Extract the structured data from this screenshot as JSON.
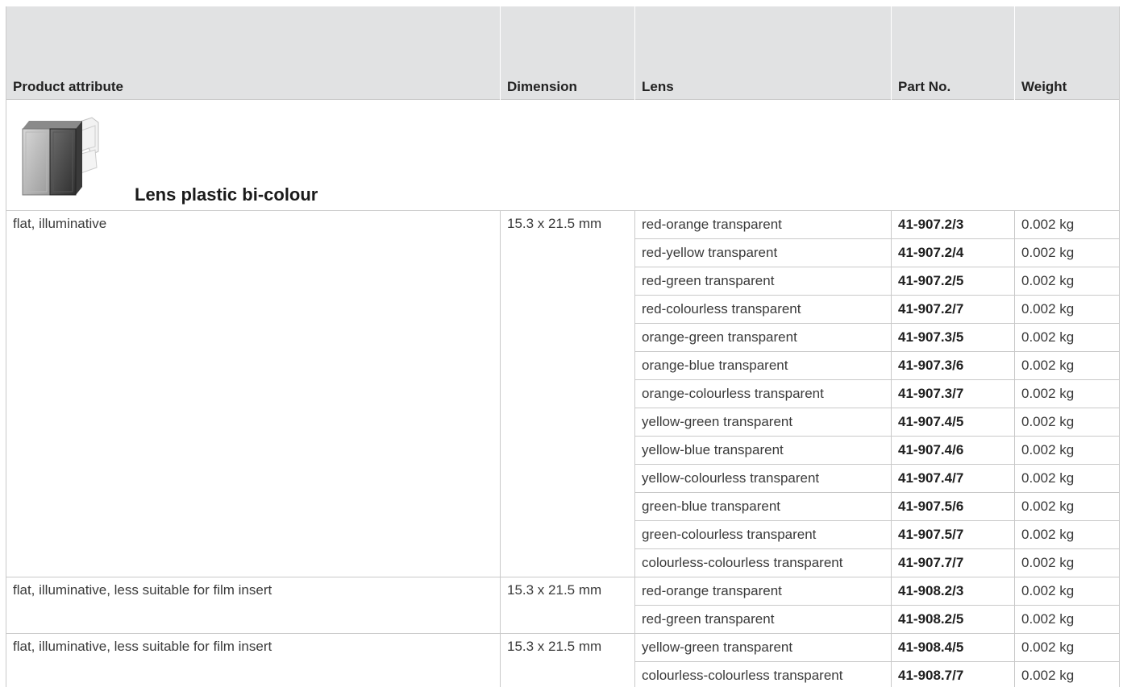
{
  "columns": {
    "attribute": "Product attribute",
    "dimension": "Dimension",
    "lens": "Lens",
    "part_no": "Part No.",
    "weight": "Weight"
  },
  "section": {
    "title": "Lens plastic bi-colour",
    "image_icon": "lens-product-image"
  },
  "groups": [
    {
      "attribute": "flat, illuminative",
      "dimension": "15.3 x 21.5 mm",
      "rows": [
        {
          "lens": "red-orange transparent",
          "part_no": "41-907.2/3",
          "weight": "0.002 kg"
        },
        {
          "lens": "red-yellow transparent",
          "part_no": "41-907.2/4",
          "weight": "0.002 kg"
        },
        {
          "lens": "red-green transparent",
          "part_no": "41-907.2/5",
          "weight": "0.002 kg"
        },
        {
          "lens": "red-colourless transparent",
          "part_no": "41-907.2/7",
          "weight": "0.002 kg"
        },
        {
          "lens": "orange-green transparent",
          "part_no": "41-907.3/5",
          "weight": "0.002 kg"
        },
        {
          "lens": "orange-blue transparent",
          "part_no": "41-907.3/6",
          "weight": "0.002 kg"
        },
        {
          "lens": "orange-colourless transparent",
          "part_no": "41-907.3/7",
          "weight": "0.002 kg"
        },
        {
          "lens": "yellow-green transparent",
          "part_no": "41-907.4/5",
          "weight": "0.002 kg"
        },
        {
          "lens": "yellow-blue transparent",
          "part_no": "41-907.4/6",
          "weight": "0.002 kg"
        },
        {
          "lens": "yellow-colourless transparent",
          "part_no": "41-907.4/7",
          "weight": "0.002 kg"
        },
        {
          "lens": "green-blue transparent",
          "part_no": "41-907.5/6",
          "weight": "0.002 kg"
        },
        {
          "lens": "green-colourless transparent",
          "part_no": "41-907.5/7",
          "weight": "0.002 kg"
        },
        {
          "lens": "colourless-colourless transparent",
          "part_no": "41-907.7/7",
          "weight": "0.002 kg"
        }
      ]
    },
    {
      "attribute": "flat, illuminative, less suitable for film insert",
      "dimension": "15.3 x 21.5 mm",
      "rows": [
        {
          "lens": "red-orange transparent",
          "part_no": "41-908.2/3",
          "weight": "0.002 kg"
        },
        {
          "lens": "red-green transparent",
          "part_no": "41-908.2/5",
          "weight": "0.002 kg"
        }
      ]
    },
    {
      "attribute": "flat, illuminative, less suitable for film insert",
      "dimension": "15.3 x 21.5 mm",
      "rows": [
        {
          "lens": "yellow-green transparent",
          "part_no": "41-908.4/5",
          "weight": "0.002 kg"
        },
        {
          "lens": "colourless-colourless transparent",
          "part_no": "41-908.7/7",
          "weight": "0.002 kg"
        }
      ]
    }
  ],
  "colors": {
    "header_bg": "#e1e2e3",
    "border": "#c9c9c9",
    "text": "#3a3a3a"
  }
}
